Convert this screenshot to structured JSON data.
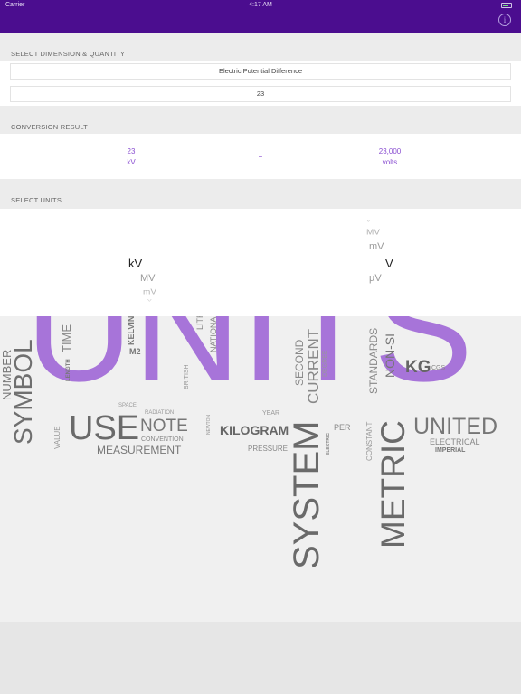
{
  "status_bar": {
    "carrier": "Carrier",
    "time": "4:17 AM"
  },
  "nav": {
    "info_label": "i"
  },
  "sections": {
    "select_header": "SELECT DIMENSION & QUANTITY",
    "result_header": "CONVERSION RESULT",
    "units_header": "SELECT UNITS"
  },
  "inputs": {
    "dimension": "Electric Potential Difference",
    "quantity": "23"
  },
  "result": {
    "from_value": "23",
    "from_unit": "kV",
    "equals": "=",
    "to_value": "23,000",
    "to_unit": "volts"
  },
  "picker": {
    "left": {
      "above": [],
      "selected": "kV",
      "below": [
        "MV",
        "mV",
        "V"
      ]
    },
    "right": {
      "above": [
        "V",
        "MV",
        "mV"
      ],
      "selected": "V",
      "below": [
        "µV"
      ]
    }
  },
  "word_cloud": [
    "UNITS",
    "USE",
    "NOTE",
    "CONVENTION",
    "MEASUREMENT",
    "SYMBOL",
    "NUMBER",
    "TIME",
    "LENGTH",
    "KELVIN",
    "M2",
    "SPACE",
    "RADIATION",
    "NATIONAL",
    "LITRE",
    "BRITISH",
    "NEWTON",
    "KILOGRAM",
    "PRESSURE",
    "YEAR",
    "SYSTEM",
    "SECOND",
    "CURRENT",
    "DEGREE",
    "PER",
    "ELECTRIC",
    "METRIC",
    "STANDARDS",
    "NON-SI",
    "CONSTANT",
    "KG",
    "CGS",
    "UNITED",
    "ELECTRICAL",
    "IMPERIAL",
    "VALUE"
  ],
  "colors": {
    "brand": "#4b0d8f",
    "accent": "#8a4fd1"
  }
}
